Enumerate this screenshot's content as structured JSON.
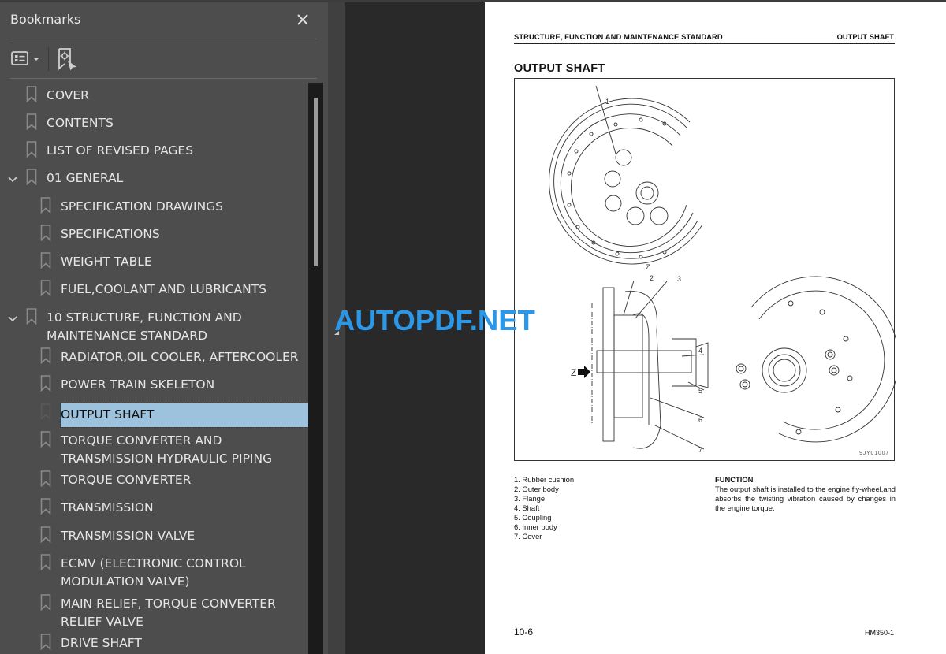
{
  "sidebar": {
    "title": "Bookmarks",
    "toolbar": {
      "options_icon": "bookmark-options-icon",
      "find_icon": "find-current-bookmark-icon"
    },
    "items": [
      {
        "label": "COVER",
        "level": 0,
        "expandable": false
      },
      {
        "label": "CONTENTS",
        "level": 0,
        "expandable": false
      },
      {
        "label": "LIST OF REVISED PAGES",
        "level": 0,
        "expandable": false
      },
      {
        "label": "01 GENERAL",
        "level": 0,
        "expandable": true,
        "expanded": true
      },
      {
        "label": "SPECIFICATION DRAWINGS",
        "level": 1
      },
      {
        "label": "SPECIFICATIONS",
        "level": 1
      },
      {
        "label": "WEIGHT TABLE",
        "level": 1
      },
      {
        "label": "FUEL,COOLANT AND LUBRICANTS",
        "level": 1
      },
      {
        "label": "10 STRUCTURE, FUNCTION AND MAINTENANCE STANDARD",
        "level": 0,
        "expandable": true,
        "expanded": true
      },
      {
        "label": "RADIATOR,OIL COOLER, AFTERCOOLER",
        "level": 1
      },
      {
        "label": "POWER TRAIN SKELETON",
        "level": 1
      },
      {
        "label": "OUTPUT SHAFT",
        "level": 1,
        "selected": true
      },
      {
        "label": "TORQUE CONVERTER AND TRANSMISSION HYDRAULIC PIPING",
        "level": 1
      },
      {
        "label": "TORQUE CONVERTER",
        "level": 1
      },
      {
        "label": "TRANSMISSION",
        "level": 1
      },
      {
        "label": "TRANSMISSION VALVE",
        "level": 1
      },
      {
        "label": "ECMV (ELECTRONIC CONTROL MODULATION VALVE)",
        "level": 1
      },
      {
        "label": "MAIN RELIEF, TORQUE CONVERTER RELIEF VALVE",
        "level": 1
      },
      {
        "label": "DRIVE SHAFT",
        "level": 1
      }
    ]
  },
  "watermark": "AUTOPDF.NET",
  "page": {
    "header_left": "STRUCTURE, FUNCTION AND MAINTENANCE STANDARD",
    "header_right": "OUTPUT SHAFT",
    "title": "OUTPUT SHAFT",
    "figure": {
      "code": "9JY01007",
      "view_label": "Z",
      "arrow_label": "Z",
      "callouts": [
        "1",
        "2",
        "3",
        "4",
        "5",
        "6",
        "7"
      ]
    },
    "parts": [
      "1. Rubber cushion",
      "2. Outer body",
      "3. Flange",
      "4. Shaft",
      "5. Coupling",
      "6. Inner body",
      "7. Cover"
    ],
    "function_title": "FUNCTION",
    "function_text": "The output shaft is installed to the engine fly-wheel,and absorbs the twisting vibration caused by changes in the engine torque.",
    "page_number": "10-6",
    "model": "HM350-1"
  },
  "colors": {
    "sidebar_bg": "#4d4d4d",
    "selection": "#9cc2de",
    "viewer_bg": "#292929",
    "watermark": "#2b97e8"
  }
}
